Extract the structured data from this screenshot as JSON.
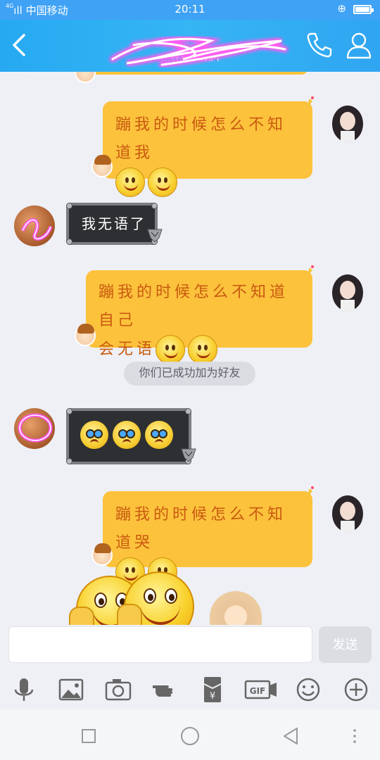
{
  "status_bar": {
    "carrier": "中国移动",
    "signal": "4G",
    "time": "20:11"
  },
  "header": {
    "title": "",
    "subtitle": "…在线 - WiFi",
    "icons": [
      "back-arrow-icon",
      "phone-icon",
      "person-icon"
    ]
  },
  "messages": [
    {
      "sender": "me",
      "text": "蹦我的时候怎么不知道我",
      "emojis": 2
    },
    {
      "sender": "other",
      "text": "我无语了"
    },
    {
      "sender": "me",
      "text": "蹦我的时候怎么不知道自己会无语",
      "line1": "蹦我的时候怎么不知道自己",
      "line2": "会无语",
      "emojis": 2
    },
    {
      "sender": "system",
      "text": "你们已成功加为好友"
    },
    {
      "sender": "other",
      "emojis": 3,
      "emoji_type": "crying"
    },
    {
      "sender": "me",
      "text": "蹦我的时候怎么不知道哭",
      "emojis": 2
    }
  ],
  "input": {
    "value": "",
    "send_label": "发送"
  },
  "toolbar": [
    "microphone-icon",
    "image-icon",
    "camera-icon",
    "pointing-hand-icon",
    "red-packet-icon",
    "gif-icon",
    "smiley-icon",
    "plus-icon"
  ],
  "toolbar_labels": {
    "gif": "GIF"
  },
  "nav": [
    "recent-apps-square-icon",
    "home-circle-icon",
    "back-triangle-icon",
    "more-dots-icon"
  ],
  "colors": {
    "header": "#35b5f4",
    "bubble_me": "#fcc23c",
    "bubble_me_text": "#c95a10",
    "bubble_other": "#2e2f32"
  }
}
